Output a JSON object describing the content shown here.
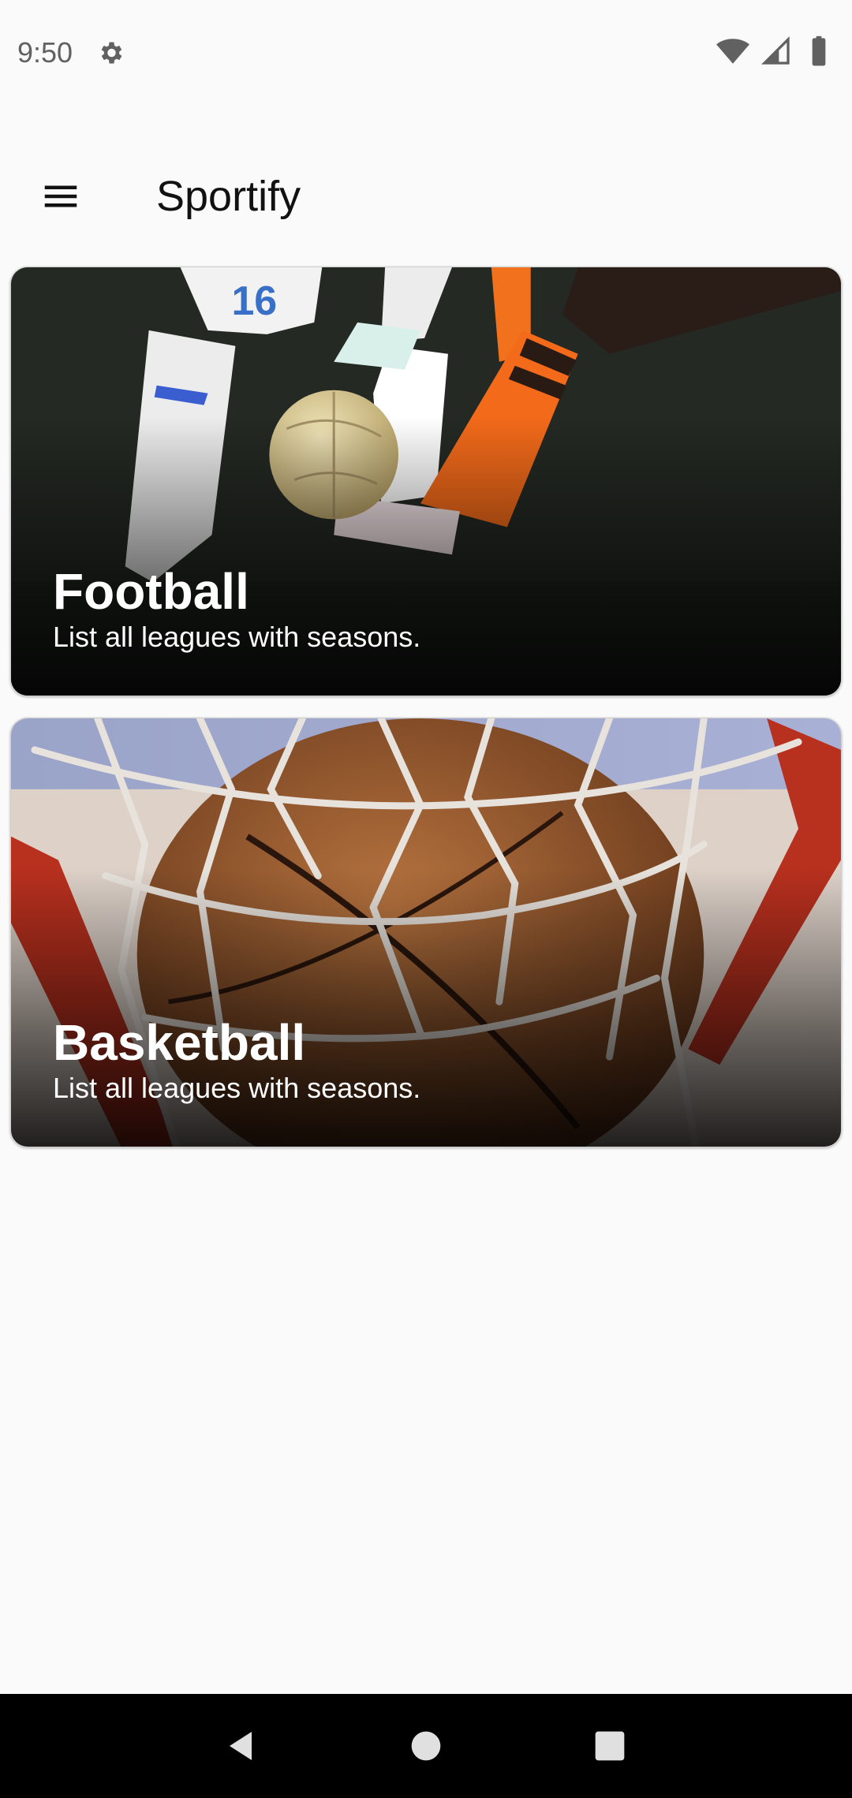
{
  "status_bar": {
    "time": "9:50",
    "icons": [
      "gear-icon",
      "wifi-icon",
      "signal-icon",
      "battery-icon"
    ]
  },
  "app_bar": {
    "title": "Sportify",
    "menu_icon": "menu-icon"
  },
  "cards": [
    {
      "title": "Football",
      "subtitle": "List all leagues with seasons."
    },
    {
      "title": "Basketball",
      "subtitle": "List all leagues with seasons."
    }
  ],
  "nav_bar": {
    "buttons": [
      "back-icon",
      "home-icon",
      "recents-icon"
    ]
  },
  "colors": {
    "background": "#fafafa",
    "nav_bar": "#000000",
    "card_text": "#ffffff"
  }
}
